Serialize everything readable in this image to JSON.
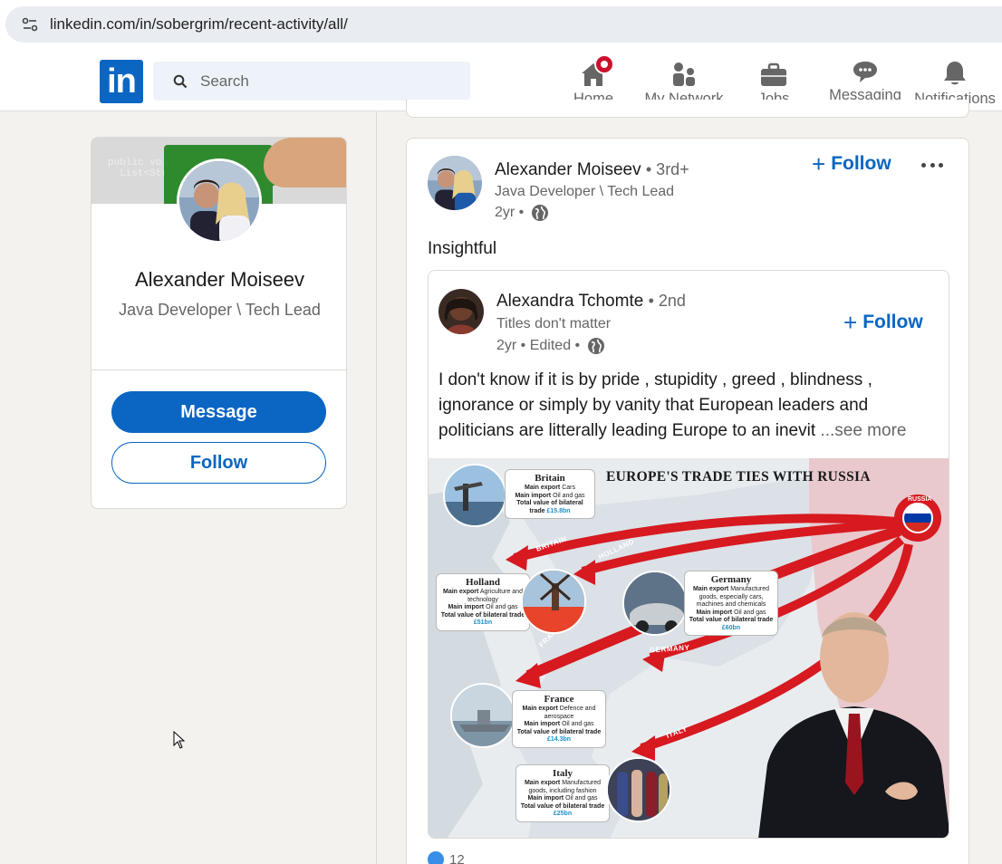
{
  "browser": {
    "url": "linkedin.com/in/sobergrim/recent-activity/all/"
  },
  "nav": {
    "search_placeholder": "Search",
    "items": [
      {
        "label": "Home",
        "icon": "home-icon"
      },
      {
        "label": "My Network",
        "icon": "people-icon"
      },
      {
        "label": "Jobs",
        "icon": "briefcase-icon"
      },
      {
        "label": "Messaging",
        "icon": "chat-icon"
      },
      {
        "label": "Notifications",
        "icon": "bell-icon"
      }
    ],
    "brand_color": "#0a66c2"
  },
  "profile": {
    "name": "Alexander Moiseev",
    "headline": "Java Developer \\ Tech Lead",
    "message_label": "Message",
    "follow_label": "Follow"
  },
  "post": {
    "author": "Alexander Moiseev",
    "degree": "• 3rd+",
    "headline": "Java Developer \\ Tech Lead",
    "time": "2yr •",
    "follow_label": "Follow",
    "commentary": "Insightful",
    "reactions_count": "12",
    "reshared": {
      "author": "Alexandra Tchomte",
      "degree": "• 2nd",
      "headline": "Titles don't matter",
      "time": "2yr • Edited •",
      "follow_label": "Follow",
      "text": "I don't know if it is by pride , stupidity , greed , blindness , ignorance or simply by vanity that European leaders and politicians are litterally leading Europe to an inevit",
      "see_more": "...see more"
    }
  },
  "infographic": {
    "title": "EUROPE'S TRADE TIES WITH RUSSIA",
    "russia_label": "RUSSIA",
    "arrow_labels": {
      "britain": "BRITAIN",
      "holland": "HOLLAND",
      "france": "FRANCE",
      "germany": "GERMANY",
      "italy": "ITALY"
    },
    "countries": {
      "britain": {
        "name": "Britain",
        "export_label": "Main export",
        "export": "Cars",
        "import_label": "Main import",
        "import": "Oil and gas",
        "total_label": "Total value of bilateral trade",
        "total": "£15.8bn"
      },
      "holland": {
        "name": "Holland",
        "export_label": "Main export",
        "export": "Agriculture and technology",
        "import_label": "Main import",
        "import": "Oil and gas",
        "total_label": "Total value of bilateral trade",
        "total": "£51bn"
      },
      "germany": {
        "name": "Germany",
        "export_label": "Main export",
        "export": "Manufactured goods, especially cars, machines and chemicals",
        "import_label": "Main import",
        "import": "Oil and gas",
        "total_label": "Total value of bilateral trade",
        "total": "£60bn"
      },
      "france": {
        "name": "France",
        "export_label": "Main export",
        "export": "Defence and aerospace",
        "import_label": "Main import",
        "import": "Oil and gas",
        "total_label": "Total value of bilateral trade",
        "total": "£14.3bn"
      },
      "italy": {
        "name": "Italy",
        "export_label": "Main export",
        "export": "Manufactured goods, including fashion",
        "import_label": "Main import",
        "import": "Oil and gas",
        "total_label": "Total value of bilateral trade",
        "total": "£25bn"
      }
    }
  }
}
